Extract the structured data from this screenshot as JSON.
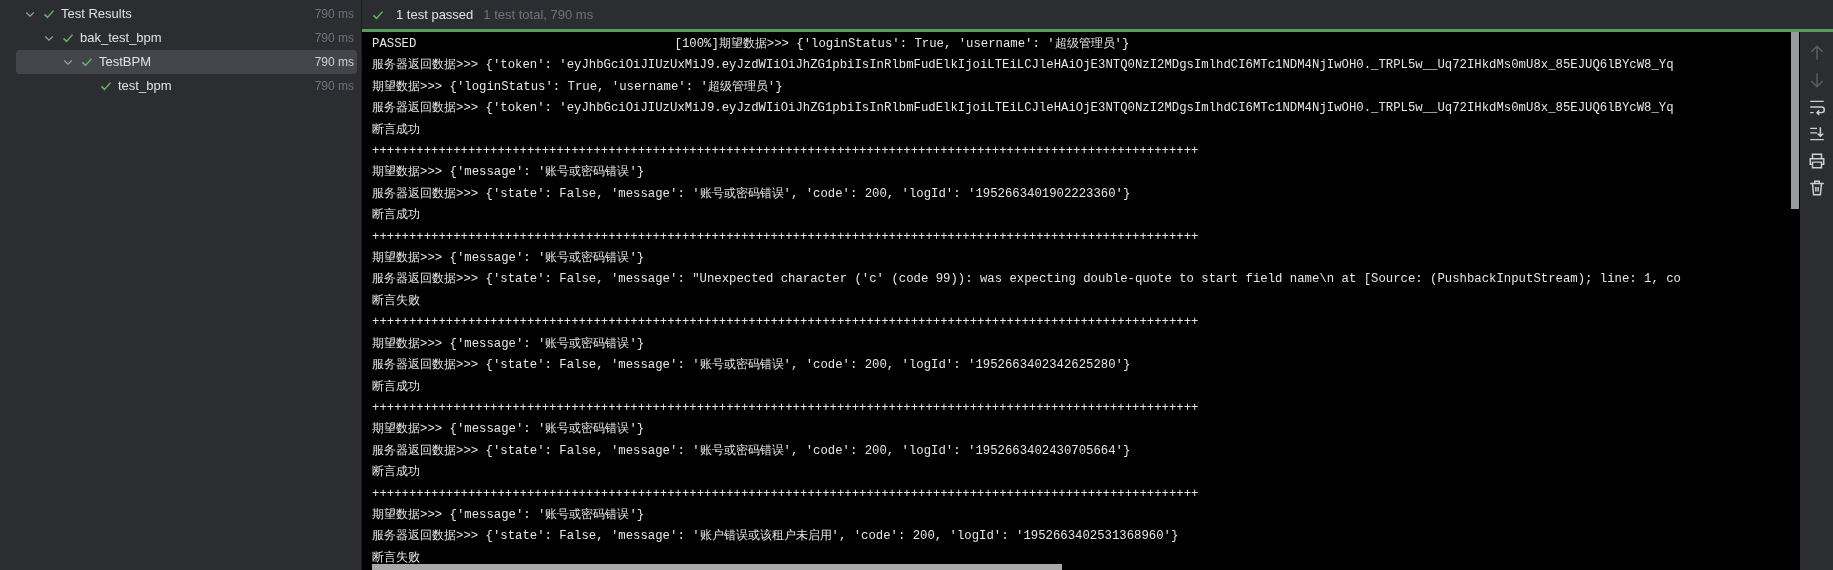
{
  "test_tree": [
    {
      "label": "Test Results",
      "time": "790 ms",
      "passed": true,
      "expanded": true,
      "selected": false,
      "children": [
        {
          "label": "bak_test_bpm",
          "time": "790 ms",
          "passed": true,
          "expanded": true,
          "selected": false,
          "children": [
            {
              "label": "TestBPM",
              "time": "790 ms",
              "passed": true,
              "expanded": true,
              "selected": true,
              "children": [
                {
                  "label": "test_bpm",
                  "time": "790 ms",
                  "passed": true,
                  "selected": false
                }
              ]
            }
          ]
        }
      ]
    }
  ],
  "summary": {
    "passed": true,
    "result": "1 test passed",
    "details": "1 test total, 790 ms"
  },
  "console": {
    "status_line": {
      "status": "PASSED",
      "text": "[100%]期望数据>>> {'loginStatus': True, 'username': '超级管理员'}"
    },
    "lines": [
      "服务器返回数据>>> {'token': 'eyJhbGciOiJIUzUxMiJ9.eyJzdWIiOiJhZG1pbiIsInRlbmFudElkIjoiLTEiLCJleHAiOjE3NTQ0NzI2MDgsImlhdCI6MTc1NDM4NjIwOH0._TRPL5w__Uq72IHkdMs0mU8x_85EJUQ6lBYcW8_Yq",
      "期望数据>>> {'loginStatus': True, 'username': '超级管理员'}",
      "服务器返回数据>>> {'token': 'eyJhbGciOiJIUzUxMiJ9.eyJzdWIiOiJhZG1pbiIsInRlbmFudElkIjoiLTEiLCJleHAiOjE3NTQ0NzI2MDgsImlhdCI6MTc1NDM4NjIwOH0._TRPL5w__Uq72IHkdMs0mU8x_85EJUQ6lBYcW8_Yq",
      "断言成功",
      "++++++++++++++++++++++++++++++++++++++++++++++++++++++++++++++++++++++++++++++++++++++++++++++++++++++++++++++++",
      "期望数据>>> {'message': '账号或密码错误'}",
      "服务器返回数据>>> {'state': False, 'message': '账号或密码错误', 'code': 200, 'logId': '1952663401902223360'}",
      "断言成功",
      "++++++++++++++++++++++++++++++++++++++++++++++++++++++++++++++++++++++++++++++++++++++++++++++++++++++++++++++++",
      "期望数据>>> {'message': '账号或密码错误'}",
      "服务器返回数据>>> {'state': False, 'message': \"Unexpected character ('c' (code 99)): was expecting double-quote to start field name\\n at [Source: (PushbackInputStream); line: 1, co",
      "断言失败",
      "++++++++++++++++++++++++++++++++++++++++++++++++++++++++++++++++++++++++++++++++++++++++++++++++++++++++++++++++",
      "期望数据>>> {'message': '账号或密码错误'}",
      "服务器返回数据>>> {'state': False, 'message': '账号或密码错误', 'code': 200, 'logId': '1952663402342625280'}",
      "断言成功",
      "++++++++++++++++++++++++++++++++++++++++++++++++++++++++++++++++++++++++++++++++++++++++++++++++++++++++++++++++",
      "期望数据>>> {'message': '账号或密码错误'}",
      "服务器返回数据>>> {'state': False, 'message': '账号或密码错误', 'code': 200, 'logId': '1952663402430705664'}",
      "断言成功",
      "++++++++++++++++++++++++++++++++++++++++++++++++++++++++++++++++++++++++++++++++++++++++++++++++++++++++++++++++",
      "期望数据>>> {'message': '账号或密码错误'}",
      "服务器返回数据>>> {'state': False, 'message': '账户错误或该租户未启用', 'code': 200, 'logId': '1952663402531368960'}",
      "断言失败"
    ]
  },
  "toolbar": [
    {
      "kind": "up",
      "disabled": true
    },
    {
      "kind": "down",
      "disabled": true
    },
    {
      "kind": "wrap",
      "disabled": false
    },
    {
      "kind": "scroll-end",
      "disabled": false
    },
    {
      "kind": "print",
      "disabled": false
    },
    {
      "kind": "delete",
      "disabled": false
    }
  ]
}
